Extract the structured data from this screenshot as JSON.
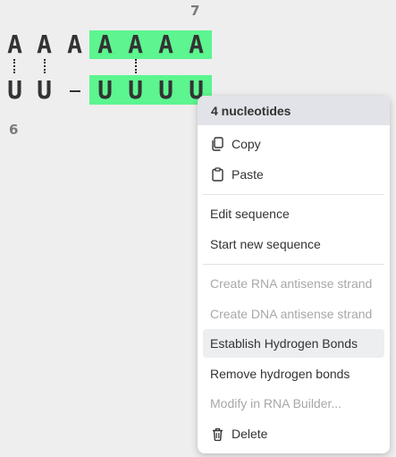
{
  "sequence": {
    "number_top": "7",
    "number_bottom": "6",
    "top_strand": [
      "A",
      "A",
      "A",
      "A",
      "A",
      "A",
      "A"
    ],
    "bottom_strand": [
      "U",
      "U",
      "U",
      "U",
      "U"
    ],
    "bottom_gap": "–"
  },
  "context_menu": {
    "header": "4 nucleotides",
    "items": {
      "copy": "Copy",
      "paste": "Paste",
      "edit_sequence": "Edit sequence",
      "start_new_sequence": "Start new sequence",
      "create_rna_antisense": "Create RNA antisense strand",
      "create_dna_antisense": "Create DNA antisense strand",
      "establish_hbonds": "Establish Hydrogen Bonds",
      "remove_hbonds": "Remove hydrogen bonds",
      "modify_rna_builder": "Modify in RNA Builder...",
      "delete": "Delete"
    },
    "icons": {
      "copy": "copy-icon",
      "paste": "clipboard-icon",
      "delete": "trash-icon"
    }
  },
  "colors": {
    "selection": "#5cf58f",
    "background": "#eeeeee",
    "menu_header": "#e1e3e8",
    "disabled_text": "#a8a8a8"
  }
}
